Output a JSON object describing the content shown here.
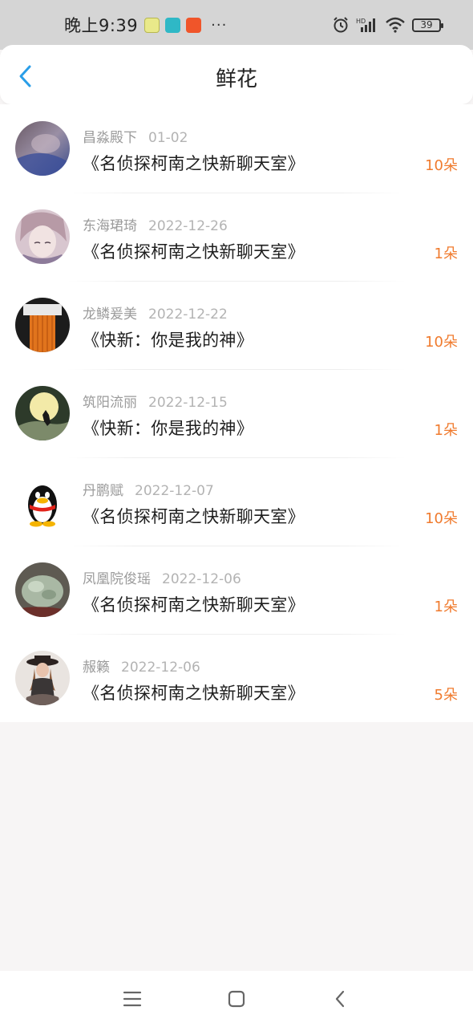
{
  "status_bar": {
    "time": "晚上9:39",
    "dots": "···",
    "battery": "39",
    "icons": [
      "wechat-notify-icon",
      "home-app-icon",
      "game-app-icon",
      "alarm-icon",
      "hd-signal-icon",
      "wifi-icon",
      "battery-icon"
    ]
  },
  "header": {
    "title": "鲜花",
    "back_icon": "chevron-left-icon"
  },
  "colors": {
    "accent": "#2a9ee8",
    "count": "#f07b2e"
  },
  "list": [
    {
      "name": "昌淼殿下",
      "date": "01-02",
      "book": "《名侦探柯南之快新聊天室》",
      "count": "10朵"
    },
    {
      "name": "东海珺琦",
      "date": "2022-12-26",
      "book": "《名侦探柯南之快新聊天室》",
      "count": "1朵"
    },
    {
      "name": "龙鳞爰美",
      "date": "2022-12-22",
      "book": "《快新：你是我的神》",
      "count": "10朵"
    },
    {
      "name": "筑阳流丽",
      "date": "2022-12-15",
      "book": "《快新：你是我的神》",
      "count": "1朵"
    },
    {
      "name": "丹鹏赋",
      "date": "2022-12-07",
      "book": "《名侦探柯南之快新聊天室》",
      "count": "10朵"
    },
    {
      "name": "凤凰院俊瑶",
      "date": "2022-12-06",
      "book": "《名侦探柯南之快新聊天室》",
      "count": "1朵"
    },
    {
      "name": "赧籁",
      "date": "2022-12-06",
      "book": "《名侦探柯南之快新聊天室》",
      "count": "5朵"
    }
  ],
  "nav": {
    "icons": [
      "menu-icon",
      "home-square-icon",
      "back-arrow-icon"
    ]
  }
}
